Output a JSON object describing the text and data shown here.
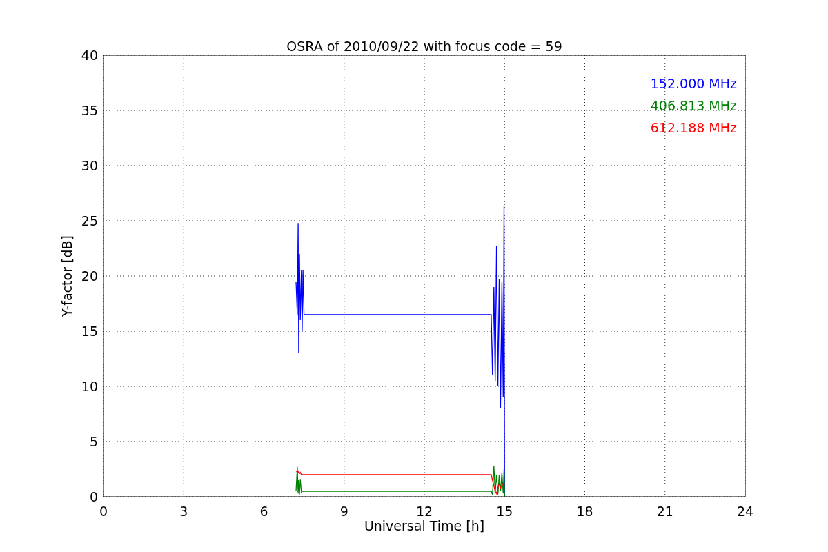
{
  "figure": {
    "chart_data": {
      "type": "line",
      "title": "OSRA of 2010/09/22 with focus code = 59",
      "xlabel": "Universal Time [h]",
      "ylabel": "Y-factor [dB]",
      "x": [
        7.2,
        7.25,
        7.28,
        7.3,
        7.33,
        7.36,
        7.4,
        7.43,
        7.46,
        7.5,
        14.5,
        14.55,
        14.6,
        14.65,
        14.7,
        14.75,
        14.8,
        14.85,
        14.9,
        14.95,
        14.98,
        15.0
      ],
      "series": [
        {
          "name": "152.000 MHz",
          "color": "#0000ff",
          "values": [
            19.5,
            16.5,
            24.8,
            13,
            22,
            16,
            20.5,
            15,
            20.5,
            16.5,
            16.5,
            11,
            19,
            10.5,
            22.7,
            10,
            19.7,
            8,
            19.5,
            9,
            26.3,
            0
          ]
        },
        {
          "name": "406.813 MHz",
          "color": "#008000",
          "values": [
            0.5,
            2.7,
            0.3,
            1.5,
            0.2,
            1.6,
            0.4,
            0.5,
            0.5,
            0.5,
            0.5,
            0.2,
            2.8,
            0.3,
            2,
            0.2,
            2,
            0.5,
            2.2,
            0.3,
            2.5,
            0
          ]
        },
        {
          "name": "612.188 MHz",
          "color": "#ff0000",
          "values": [
            2.3,
            2.3,
            2.2,
            2.3,
            2.1,
            2.2,
            2.0,
            2.0,
            2.0,
            2.0,
            2.0,
            1.5,
            1.0,
            0.5,
            0.3,
            0.8,
            1.2,
            0.8,
            1.0,
            1.2,
            1.3,
            null
          ]
        }
      ],
      "xlim": [
        0,
        24
      ],
      "ylim": [
        0,
        40
      ],
      "xticks": [
        0,
        3,
        6,
        9,
        12,
        15,
        18,
        21,
        24
      ],
      "yticks": [
        0,
        5,
        10,
        15,
        20,
        25,
        30,
        35,
        40
      ],
      "grid": true
    }
  }
}
